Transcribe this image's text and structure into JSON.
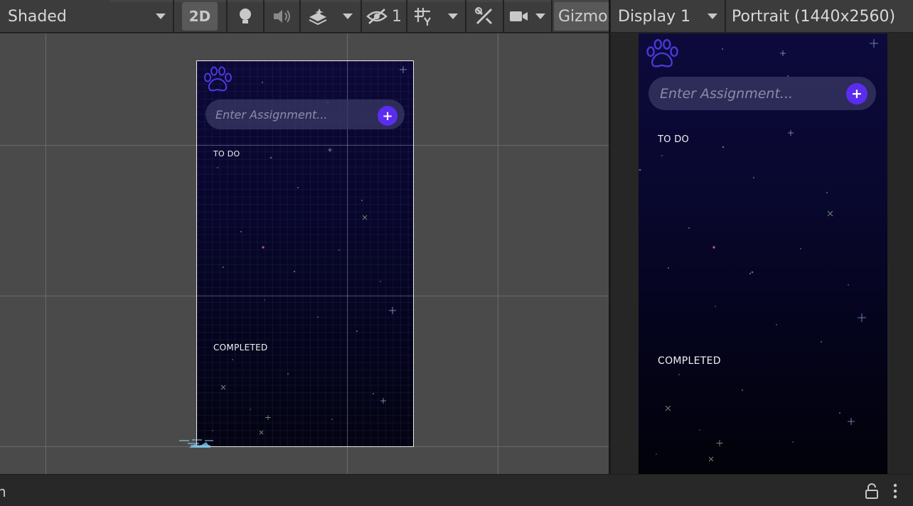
{
  "scene_toolbar": {
    "shading_mode": "Shaded",
    "mode_2d_label": "2D",
    "hidden_count": "1",
    "gizmos_label": "Gizmos"
  },
  "game_toolbar": {
    "display": "Display 1",
    "resolution": "Portrait (1440x2560)"
  },
  "app": {
    "input_placeholder": "Enter Assignment...",
    "add_button": "+",
    "todo_label": "TO DO",
    "completed_label": "COMPLETED",
    "accent_color": "#5b2cf0",
    "paw_color": "#4a3ae0"
  },
  "status_bar": {
    "text": "n"
  },
  "icons": [
    "scene-lighting-icon",
    "audio-icon",
    "effects-icon",
    "visibility-icon",
    "grid-snap-icon",
    "tools-icon",
    "camera-icon",
    "paw-icon",
    "lock-icon",
    "more-icon"
  ]
}
